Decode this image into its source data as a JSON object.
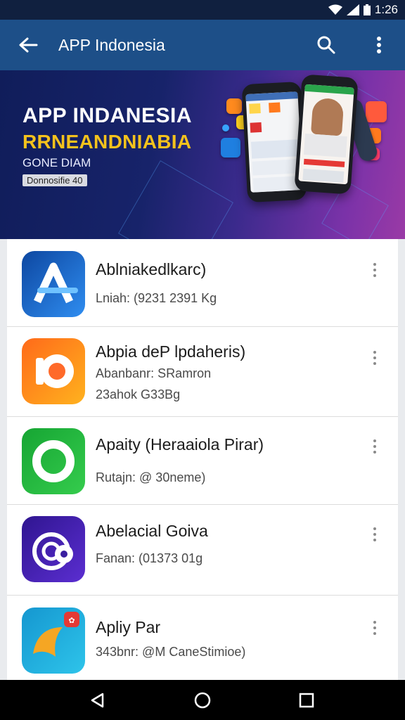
{
  "status_bar": {
    "time": "1:26"
  },
  "app_bar": {
    "title": "APP Indonesia"
  },
  "banner": {
    "headline": "APP INDANESIA",
    "subhead": "RRNEANDNIABIA",
    "tagline": "GONE DIAM",
    "chip": "Donnosifie 40"
  },
  "apps": [
    {
      "name": "Ablniakedlkarc)",
      "lines": [
        "Lniah: (9231 2391 Kg"
      ],
      "colors": [
        "#1565c0",
        "#2196f3"
      ]
    },
    {
      "name": "Abpia deP lpdaheris)",
      "lines": [
        "Abanbanr: SRamron",
        "23ahok G33Bg"
      ],
      "colors": [
        "#ff7a1a",
        "#ffb020"
      ]
    },
    {
      "name": "Apaity (Heraaiola Pirar)",
      "lines": [
        "Rutajn: @ 30neme)"
      ],
      "colors": [
        "#1fae3a",
        "#33cc4f"
      ]
    },
    {
      "name": "Abelacial Goiva",
      "lines": [
        "Fanan: (01373 01g"
      ],
      "colors": [
        "#3a1fa0",
        "#5e2fd0"
      ]
    },
    {
      "name": "Apliy Par",
      "lines": [
        "343bnr: @M CaneStimioe)"
      ],
      "colors": [
        "#1ba0d8",
        "#28c0e8"
      ]
    }
  ]
}
